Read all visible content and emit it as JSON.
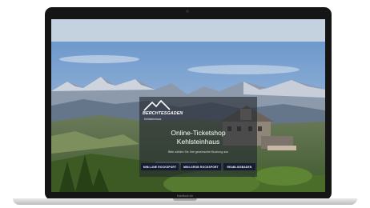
{
  "device": {
    "brand_label": "MacBook Air"
  },
  "logo": {
    "title": "BERCHTESGADEN",
    "subtitle": "Kehlsteinhaus"
  },
  "hero": {
    "title_line1": "Online-Ticketshop",
    "title_line2": "Kehlsteinhaus",
    "select_hint": "Bitte wählen Sie Ihre gewünschte Buchung aus"
  },
  "buttons": [
    {
      "label": "MINI-LINE ROCKSPORT"
    },
    {
      "label": "MINI-GROB ROCKSPORT"
    },
    {
      "label": "REABLISSBADEN"
    }
  ],
  "colors": {
    "button_bg": "#141c33",
    "laptop_bezel": "#151515",
    "overlay": "#23282f"
  }
}
